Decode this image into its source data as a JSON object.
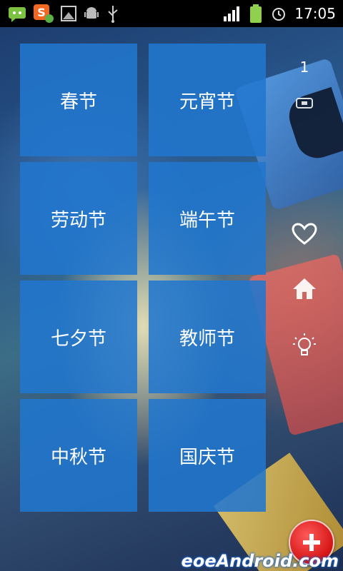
{
  "status_bar": {
    "time": "17:05",
    "icons": [
      "sms-icon",
      "sogou-input-icon",
      "image-icon",
      "android-icon",
      "usb-icon",
      "signal-icon",
      "battery-icon",
      "alarm-icon"
    ]
  },
  "tiles": [
    {
      "label": "春节"
    },
    {
      "label": "元宵节"
    },
    {
      "label": "劳动节"
    },
    {
      "label": "端午节"
    },
    {
      "label": "七夕节"
    },
    {
      "label": "教师节"
    },
    {
      "label": "中秋节"
    },
    {
      "label": "国庆节"
    }
  ],
  "side_rail": {
    "count": "1",
    "icons": [
      "card-icon",
      "heart-icon",
      "home-icon",
      "lightbulb-icon"
    ]
  },
  "fab": {
    "icon": "plus-icon"
  },
  "watermark": "eoeAndroid.com",
  "colors": {
    "tile": "#2176ce",
    "fab": "#d51414",
    "statusbar": "#000000"
  }
}
